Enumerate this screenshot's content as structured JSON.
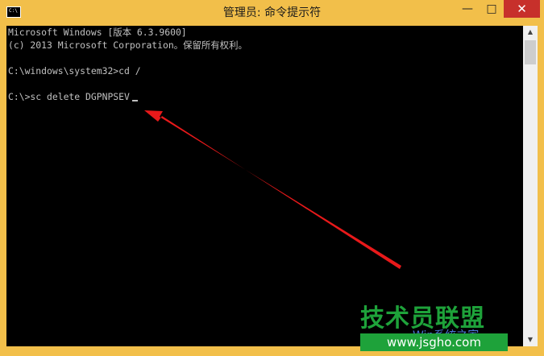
{
  "window": {
    "icon_label": "C:\\",
    "title": "管理员: 命令提示符",
    "controls": {
      "minimize": "—",
      "maximize": "□",
      "close": "✕"
    }
  },
  "console": {
    "lines": [
      "Microsoft Windows [版本 6.3.9600]",
      "(c) 2013 Microsoft Corporation。保留所有权利。",
      "C:\\windows\\system32>cd /",
      "C:\\>sc delete DGPNPSEV"
    ]
  },
  "scrollbar": {
    "up": "▲",
    "down": "▼"
  },
  "watermark": {
    "title": "技术员联盟",
    "subtitle": "Win系统之家",
    "url": "www.jsgho.com"
  },
  "colors": {
    "title_bar": "#f2bf4a",
    "console_bg": "#000000",
    "console_text": "#c0c0c0",
    "close_button": "#c7302b",
    "arrow": "#e8191a",
    "watermark_green": "#1ea23a"
  }
}
